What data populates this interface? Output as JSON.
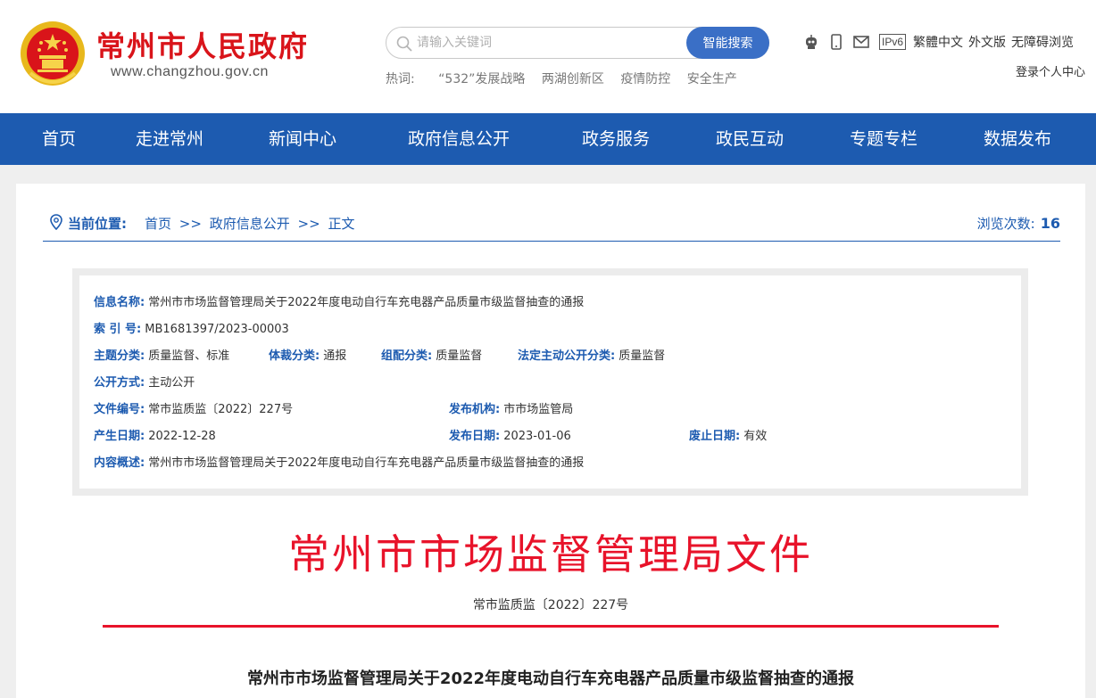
{
  "header": {
    "title": "常州市人民政府",
    "url": "www.changzhou.gov.cn",
    "search": {
      "placeholder": "请输入关键词",
      "button": "智能搜索"
    },
    "hotwords": {
      "label": "热词:",
      "items": [
        "“532”发展战略",
        "两湖创新区",
        "疫情防控",
        "安全生产"
      ]
    },
    "tools": {
      "ipv6": "IPv6",
      "traditional": "繁體中文",
      "foreign": "外文版",
      "accessible": "无障碍浏览",
      "login": "登录个人中心"
    }
  },
  "nav": [
    "首页",
    "走进常州",
    "新闻中心",
    "政府信息公开",
    "政务服务",
    "政民互动",
    "专题专栏",
    "数据发布"
  ],
  "breadcrumb": {
    "label": "当前位置:",
    "path": [
      "首页",
      ">>",
      "政府信息公开",
      ">>",
      "正文"
    ],
    "views_label": "浏览次数:",
    "views": "16"
  },
  "meta": {
    "name_key": "信息名称:",
    "name": "常州市市场监督管理局关于2022年度电动自行车充电器产品质量市级监督抽查的通报",
    "index_key": "索 引 号:",
    "index": "MB1681397/2023-00003",
    "topic_key": "主题分类:",
    "topic": "质量监督、标准",
    "genre_key": "体裁分类:",
    "genre": "通报",
    "org_cat_key": "组配分类:",
    "org_cat": "质量监督",
    "legal_cat_key": "法定主动公开分类:",
    "legal_cat": "质量监督",
    "mode_key": "公开方式:",
    "mode": "主动公开",
    "file_no_key": "文件编号:",
    "file_no": "常市监质监〔2022〕227号",
    "publisher_key": "发布机构:",
    "publisher": "市市场监管局",
    "created_key": "产生日期:",
    "created": "2022-12-28",
    "published_key": "发布日期:",
    "published": "2023-01-06",
    "expire_key": "废止日期:",
    "expire": "有效",
    "summary_key": "内容概述:",
    "summary": "常州市市场监督管理局关于2022年度电动自行车充电器产品质量市级监督抽查的通报"
  },
  "document": {
    "org": "常州市市场监督管理局文件",
    "number": "常市监质监〔2022〕227号",
    "title": "常州市市场监督管理局关于2022年度电动自行车充电器产品质量市级监督抽查的通报"
  },
  "colors": {
    "brand_red": "#d9141a",
    "nav_blue": "#1d5bb0",
    "doc_red": "#e8132a"
  }
}
